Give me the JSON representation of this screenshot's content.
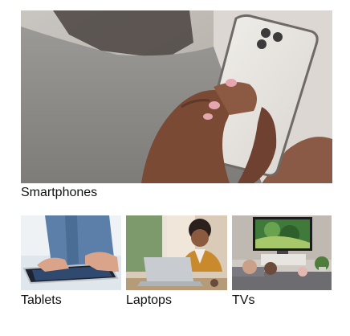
{
  "featured": {
    "label": "Smartphones",
    "image": "woman-holding-smartphone-photo"
  },
  "tiles": [
    {
      "label": "Tablets",
      "image": "hands-using-tablet-photo"
    },
    {
      "label": "Laptops",
      "image": "woman-using-laptop-photo"
    },
    {
      "label": "TVs",
      "image": "living-room-tv-photo"
    }
  ]
}
